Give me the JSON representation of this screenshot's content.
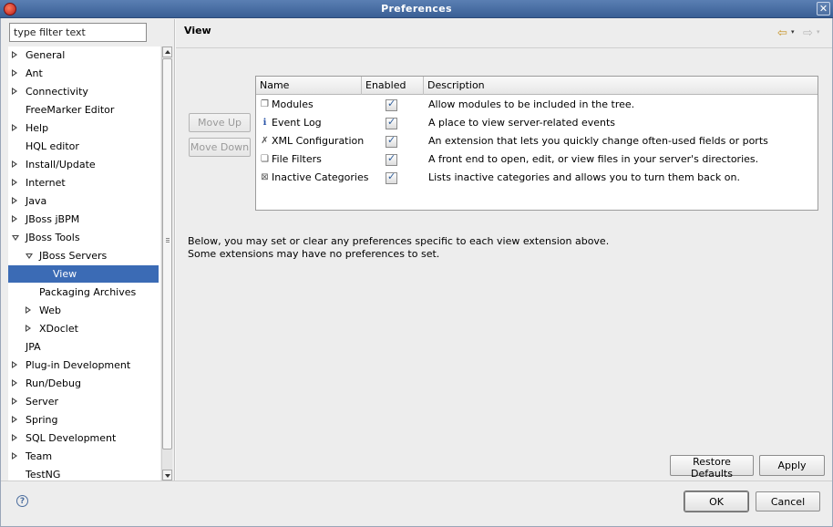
{
  "window": {
    "title": "Preferences",
    "close_glyph": "✕"
  },
  "filter": {
    "value": "type filter text"
  },
  "tree": [
    {
      "label": "General",
      "twisty": "collapsed",
      "depth": 0
    },
    {
      "label": "Ant",
      "twisty": "collapsed",
      "depth": 0
    },
    {
      "label": "Connectivity",
      "twisty": "collapsed",
      "depth": 0
    },
    {
      "label": "FreeMarker Editor",
      "twisty": "none",
      "depth": 0
    },
    {
      "label": "Help",
      "twisty": "collapsed",
      "depth": 0
    },
    {
      "label": "HQL editor",
      "twisty": "none",
      "depth": 0
    },
    {
      "label": "Install/Update",
      "twisty": "collapsed",
      "depth": 0
    },
    {
      "label": "Internet",
      "twisty": "collapsed",
      "depth": 0
    },
    {
      "label": "Java",
      "twisty": "collapsed",
      "depth": 0
    },
    {
      "label": "JBoss jBPM",
      "twisty": "collapsed",
      "depth": 0
    },
    {
      "label": "JBoss Tools",
      "twisty": "expanded",
      "depth": 0
    },
    {
      "label": "JBoss Servers",
      "twisty": "expanded",
      "depth": 1
    },
    {
      "label": "View",
      "twisty": "none",
      "depth": 2,
      "selected": true
    },
    {
      "label": "Packaging Archives",
      "twisty": "none",
      "depth": 1
    },
    {
      "label": "Web",
      "twisty": "collapsed",
      "depth": 1
    },
    {
      "label": "XDoclet",
      "twisty": "collapsed",
      "depth": 1
    },
    {
      "label": "JPA",
      "twisty": "none",
      "depth": 0
    },
    {
      "label": "Plug-in Development",
      "twisty": "collapsed",
      "depth": 0
    },
    {
      "label": "Run/Debug",
      "twisty": "collapsed",
      "depth": 0
    },
    {
      "label": "Server",
      "twisty": "collapsed",
      "depth": 0
    },
    {
      "label": "Spring",
      "twisty": "collapsed",
      "depth": 0
    },
    {
      "label": "SQL Development",
      "twisty": "collapsed",
      "depth": 0
    },
    {
      "label": "Team",
      "twisty": "collapsed",
      "depth": 0
    },
    {
      "label": "TestNG",
      "twisty": "none",
      "depth": 0
    }
  ],
  "page": {
    "title": "View",
    "nav_back_glyph": "⇦",
    "nav_fwd_glyph": "⇨",
    "nav_drop_glyph": "▾"
  },
  "buttons": {
    "move_up": "Move Up",
    "move_down": "Move Down",
    "restore_defaults": "Restore Defaults",
    "apply": "Apply",
    "ok": "OK",
    "cancel": "Cancel"
  },
  "table": {
    "columns": [
      "Name",
      "Enabled",
      "Description"
    ],
    "rows": [
      {
        "name": "Modules",
        "icon": "module-icon",
        "icon_glyph": "❐",
        "enabled": true,
        "description": "Allow modules to be included in the tree."
      },
      {
        "name": "Event Log",
        "icon": "info-icon",
        "icon_glyph": "ℹ",
        "enabled": true,
        "description": "A place to view server-related events"
      },
      {
        "name": "XML Configuration",
        "icon": "xml-icon",
        "icon_glyph": "✗",
        "enabled": true,
        "description": "An extension that lets you quickly change often-used fields or ports"
      },
      {
        "name": "File Filters",
        "icon": "file-filter-icon",
        "icon_glyph": "❏",
        "enabled": true,
        "description": "A front end to open, edit, or view files in your server's directories."
      },
      {
        "name": "Inactive Categories",
        "icon": "category-icon",
        "icon_glyph": "⊠",
        "enabled": true,
        "description": "Lists inactive categories and allows you to turn them back on."
      }
    ]
  },
  "info": {
    "line1": "Below, you may set or clear any preferences specific to each view extension above.",
    "line2": "Some extensions may have no preferences to set."
  },
  "help": {
    "glyph": "?"
  }
}
